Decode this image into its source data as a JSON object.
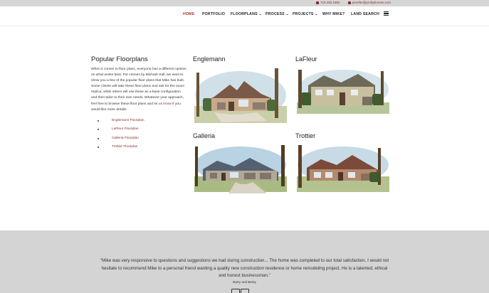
{
  "topbar": {
    "phone": "719.492.1892",
    "email": "jennifer@prohphomes.com"
  },
  "nav": {
    "items": [
      "HOME",
      "PORTFOLIO",
      "FLOORPLANS ⌄",
      "PROCESS ⌄",
      "PROJECTS ⌄",
      "WHY MIKE?",
      "LAND SEARCH"
    ],
    "active": "HOME"
  },
  "intro": {
    "title": "Popular Floorplans",
    "body_before_link": "When it comes to floor plans, everyone has a different opinion on what works best. For Homes by Michael Hall, we want to show you a few of the popular floor plans that Mike has built. Some clients will take these floor plans and ask for the exact replica, while others will use these as a base configuration and then tailor to their own needs.  Whatever your approach, feel free to browse these floor plans and ",
    "link_text": "let us know",
    "body_after_link": " if you would like more details.",
    "links": [
      "Englemann Floorplan",
      "LaFleur Floorplan",
      "Galleria Floorplan",
      "Trottier Floorplan"
    ]
  },
  "plans": [
    {
      "name": "Englemann"
    },
    {
      "name": "LaFleur"
    },
    {
      "name": "Galleria"
    },
    {
      "name": "Trottier"
    }
  ],
  "testimonial": {
    "quote": "\"Mike was very responsive to questions and suggestions we had during construction... The home was completed to our total satisfaction. I would not hesitate to recommend Mike to a personal friend wanting a quality new construction residence or home remodeling project. He is a talented, ethical and honest businessman.\"",
    "author": "Barry and Betsy"
  }
}
